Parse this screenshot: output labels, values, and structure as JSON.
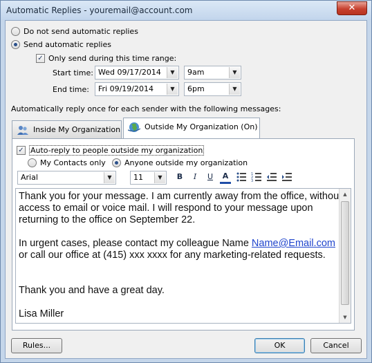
{
  "window": {
    "title": "Automatic Replies - youremail@account.com",
    "close_label": "✕"
  },
  "options": {
    "do_not_send": "Do not send automatic replies",
    "send": "Send automatic replies",
    "time_range": "Only send during this time range:"
  },
  "schedule": {
    "start_label": "Start time:",
    "start_date": "Wed 09/17/2014",
    "start_time": "9am",
    "end_label": "End time:",
    "end_date": "Fri 09/19/2014",
    "end_time": "6pm"
  },
  "instructions": "Automatically reply once for each sender with the following messages:",
  "tabs": [
    {
      "label": "Inside My Organization",
      "icon": "people-icon"
    },
    {
      "label": "Outside My Organization (On)",
      "icon": "globe-icon"
    }
  ],
  "outside": {
    "auto_reply_label": "Auto-reply to people outside my organization",
    "my_contacts": "My Contacts only",
    "anyone": "Anyone outside my organization"
  },
  "toolbar": {
    "font": "Arial",
    "size": "11",
    "bold": "B",
    "italic": "I",
    "underline": "U",
    "font_color": "A"
  },
  "message": {
    "p1": "Thank you for your message. I am currently away from the office, without access to email or voice mail. I will respond to your message upon returning to the office on September 22.",
    "p2_before": "In urgent cases, please contact my colleague Name ",
    "p2_link": "Name@Email.com",
    "p2_after": " or call our office at (415) xxx xxxx for any marketing-related requests.",
    "p3": "Thank you and have a great day.",
    "signature": "Lisa Miller"
  },
  "buttons": {
    "rules": "Rules...",
    "ok": "OK",
    "cancel": "Cancel"
  },
  "colors": {
    "accent": "#3c7fb1",
    "link": "#1f44cc",
    "font_color_bar": "#1f4ea8"
  }
}
